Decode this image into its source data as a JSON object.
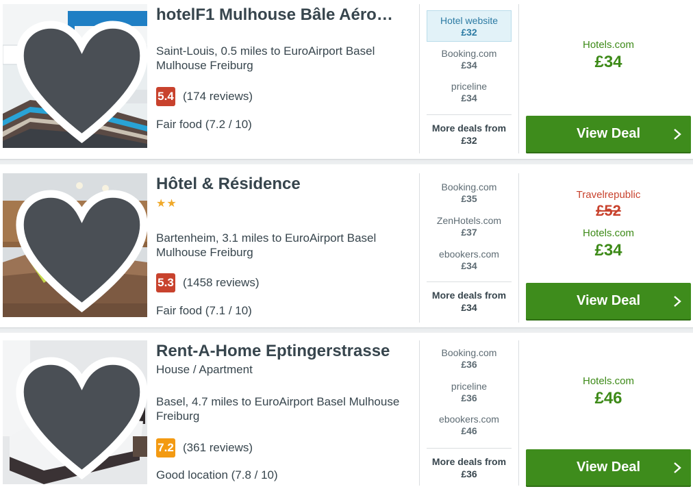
{
  "hotels": [
    {
      "name": "hotelF1 Mulhouse Bâle Aéro…",
      "stars": "",
      "subtype": "",
      "location": "Saint-Louis, 0.5 miles to EuroAirport Basel Mulhouse Freiburg",
      "score": "5.4",
      "reviews": "(174 reviews)",
      "feature": "Fair food (7.2 / 10)",
      "deals": [
        {
          "provider": "Hotel website",
          "price": "£32"
        },
        {
          "provider": "Booking.com",
          "price": "£34"
        },
        {
          "provider": "priceline",
          "price": "£34"
        }
      ],
      "more_label": "More deals from",
      "more_price": "£32",
      "old_provider": "",
      "old_price": "",
      "best_provider": "Hotels.com",
      "best_price": "£34",
      "button": "View Deal"
    },
    {
      "name": "Hôtel & Résidence",
      "stars": "★★",
      "subtype": "",
      "location": "Bartenheim, 3.1 miles to EuroAirport Basel Mulhouse Freiburg",
      "score": "5.3",
      "reviews": "(1458 reviews)",
      "feature": "Fair food (7.1 / 10)",
      "deals": [
        {
          "provider": "Booking.com",
          "price": "£35"
        },
        {
          "provider": "ZenHotels.com",
          "price": "£37"
        },
        {
          "provider": "ebookers.com",
          "price": "£34"
        }
      ],
      "more_label": "More deals from",
      "more_price": "£34",
      "old_provider": "Travelrepublic",
      "old_price": "£52",
      "best_provider": "Hotels.com",
      "best_price": "£34",
      "button": "View Deal"
    },
    {
      "name": "Rent-A-Home Eptingerstrasse",
      "stars": "",
      "subtype": "House / Apartment",
      "location": "Basel, 4.7 miles to EuroAirport Basel Mulhouse Freiburg",
      "score": "7.2",
      "reviews": "(361 reviews)",
      "feature": "Good location (7.8 / 10)",
      "deals": [
        {
          "provider": "Booking.com",
          "price": "£36"
        },
        {
          "provider": "priceline",
          "price": "£36"
        },
        {
          "provider": "ebookers.com",
          "price": "£46"
        }
      ],
      "more_label": "More deals from",
      "more_price": "£36",
      "old_provider": "",
      "old_price": "",
      "best_provider": "Hotels.com",
      "best_price": "£46",
      "button": "View Deal"
    }
  ],
  "icons": {
    "favorite": "heart-icon",
    "chevron": "chevron-right-icon",
    "photo": "hotel-photo"
  },
  "colors": {
    "deal_green": "#3e8c1c",
    "score_red": "#c8422d",
    "score_orange": "#f39a12",
    "highlight_blue": "#e2f2f8"
  }
}
